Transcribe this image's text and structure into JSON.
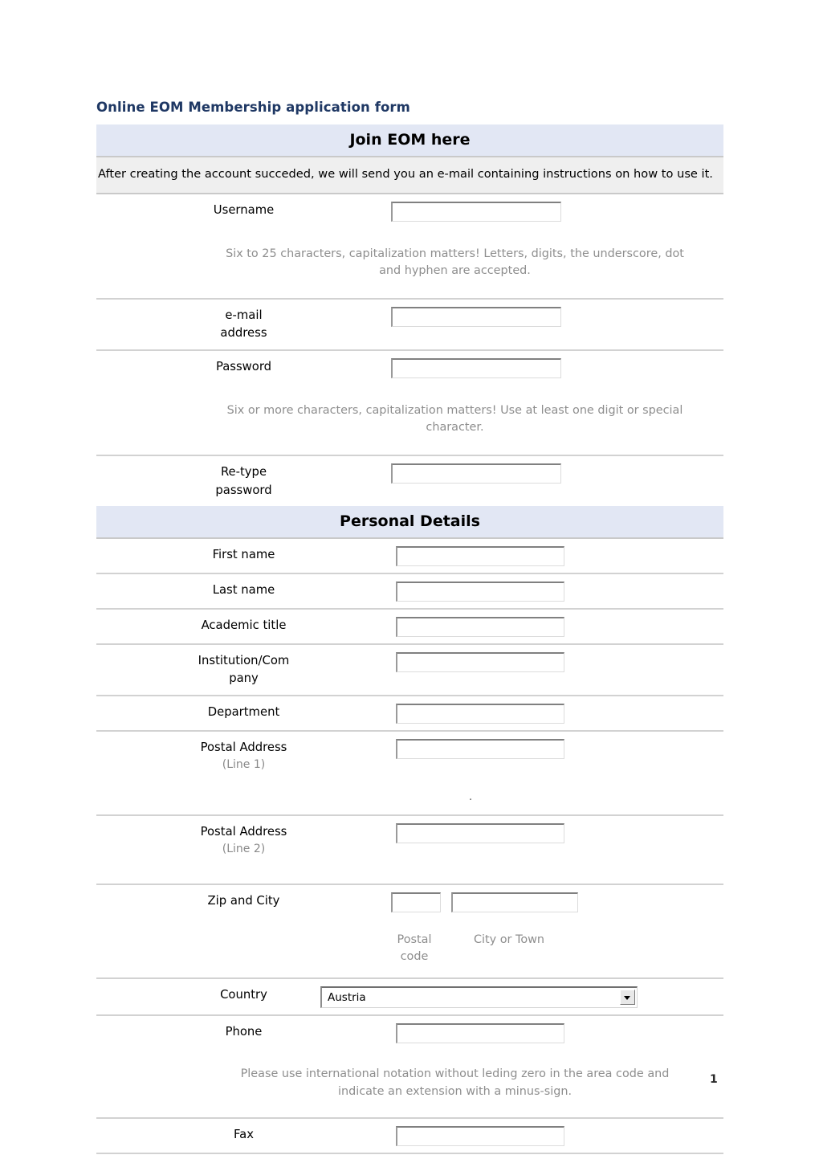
{
  "document": {
    "title": "Online EOM Membership application form",
    "page_number": "1",
    "title_color": "#1f3864",
    "section_bar_color": "#e2e7f4",
    "intro_block_color": "#efefef",
    "hint_text_color": "#8e8e8e"
  },
  "sections": [
    {
      "id": "join",
      "heading": "Join EOM here",
      "intro": "After creating the account succeded, we will send you an e-mail containing instructions on how to use it."
    },
    {
      "id": "personal",
      "heading": "Personal Details"
    }
  ],
  "fields": {
    "username": {
      "label": "Username",
      "value": "",
      "placeholder": "",
      "hint": "Six to 25 characters, capitalization matters! Letters, digits, the underscore, dot and hyphen are accepted."
    },
    "email": {
      "label_line1": "e-mail",
      "label_line2": "address",
      "value": "",
      "placeholder": ""
    },
    "password": {
      "label": "Password",
      "value": "",
      "placeholder": "",
      "hint": "Six or more characters, capitalization matters! Use at least one digit or special character."
    },
    "retype_password": {
      "label_line1": "Re-type",
      "label_line2": "password",
      "value": "",
      "placeholder": ""
    },
    "first_name": {
      "label": "First name",
      "value": "",
      "placeholder": ""
    },
    "last_name": {
      "label": "Last name",
      "value": "",
      "placeholder": ""
    },
    "academic_title": {
      "label": "Academic title",
      "value": "",
      "placeholder": ""
    },
    "institution": {
      "label_line1": "Institution/Com",
      "label_line2": "pany",
      "value": "",
      "placeholder": ""
    },
    "department": {
      "label": "Department",
      "value": "",
      "placeholder": ""
    },
    "postal_address_1": {
      "label": "Postal Address",
      "sub_label": "(Line 1)",
      "value": "",
      "placeholder": "",
      "stray_mark": "."
    },
    "postal_address_2": {
      "label": "Postal Address",
      "sub_label": "(Line 2)",
      "value": "",
      "placeholder": ""
    },
    "zip_and_city": {
      "label": "Zip and City",
      "zip_value": "",
      "zip_placeholder": "",
      "zip_caption_line1": "Postal",
      "zip_caption_line2": "code",
      "city_value": "",
      "city_placeholder": "",
      "city_caption": "City or Town"
    },
    "country": {
      "label": "Country",
      "selected": "Austria",
      "options": [
        "Austria"
      ]
    },
    "phone": {
      "label": "Phone",
      "value": "",
      "placeholder": "",
      "hint": "Please use international notation without leding zero in the area code and indicate an extension with a minus-sign."
    },
    "fax": {
      "label": "Fax",
      "value": "",
      "placeholder": ""
    }
  }
}
